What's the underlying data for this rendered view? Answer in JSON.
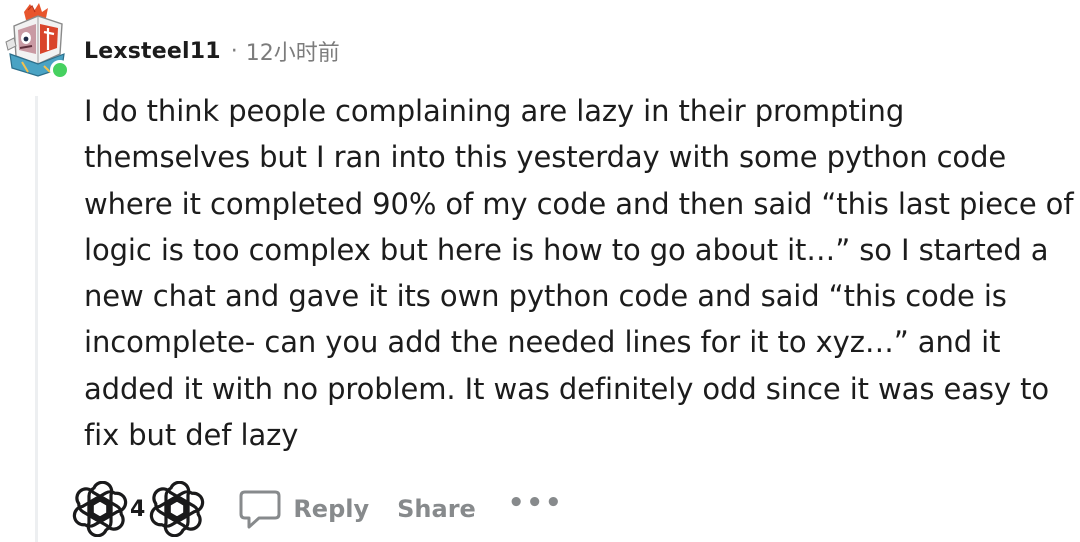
{
  "comment": {
    "author": "Lexsteel11",
    "separator": "·",
    "timestamp": "12小时前",
    "body": "I do think people complaining are lazy in their prompting themselves but I ran into this yesterday with some python code where it completed 90% of my code and then said “this last piece of logic is too complex but here is how to go about it…” so I started a new chat and gave it its own python code and said “this code is incomplete- can you add the needed lines for it to xyz…” and it added it with no problem. It was definitely odd since it was easy to fix but def lazy",
    "online": true
  },
  "actions": {
    "upvote_icon": "openai-logo-icon",
    "vote_count": "4",
    "downvote_icon": "openai-logo-icon",
    "reply_icon": "speech-bubble-icon",
    "reply_label": "Reply",
    "share_label": "Share",
    "more_label": "•••"
  },
  "colors": {
    "online_dot": "#46d160",
    "muted_text": "#878a8c",
    "thread_line": "#edeff1"
  }
}
